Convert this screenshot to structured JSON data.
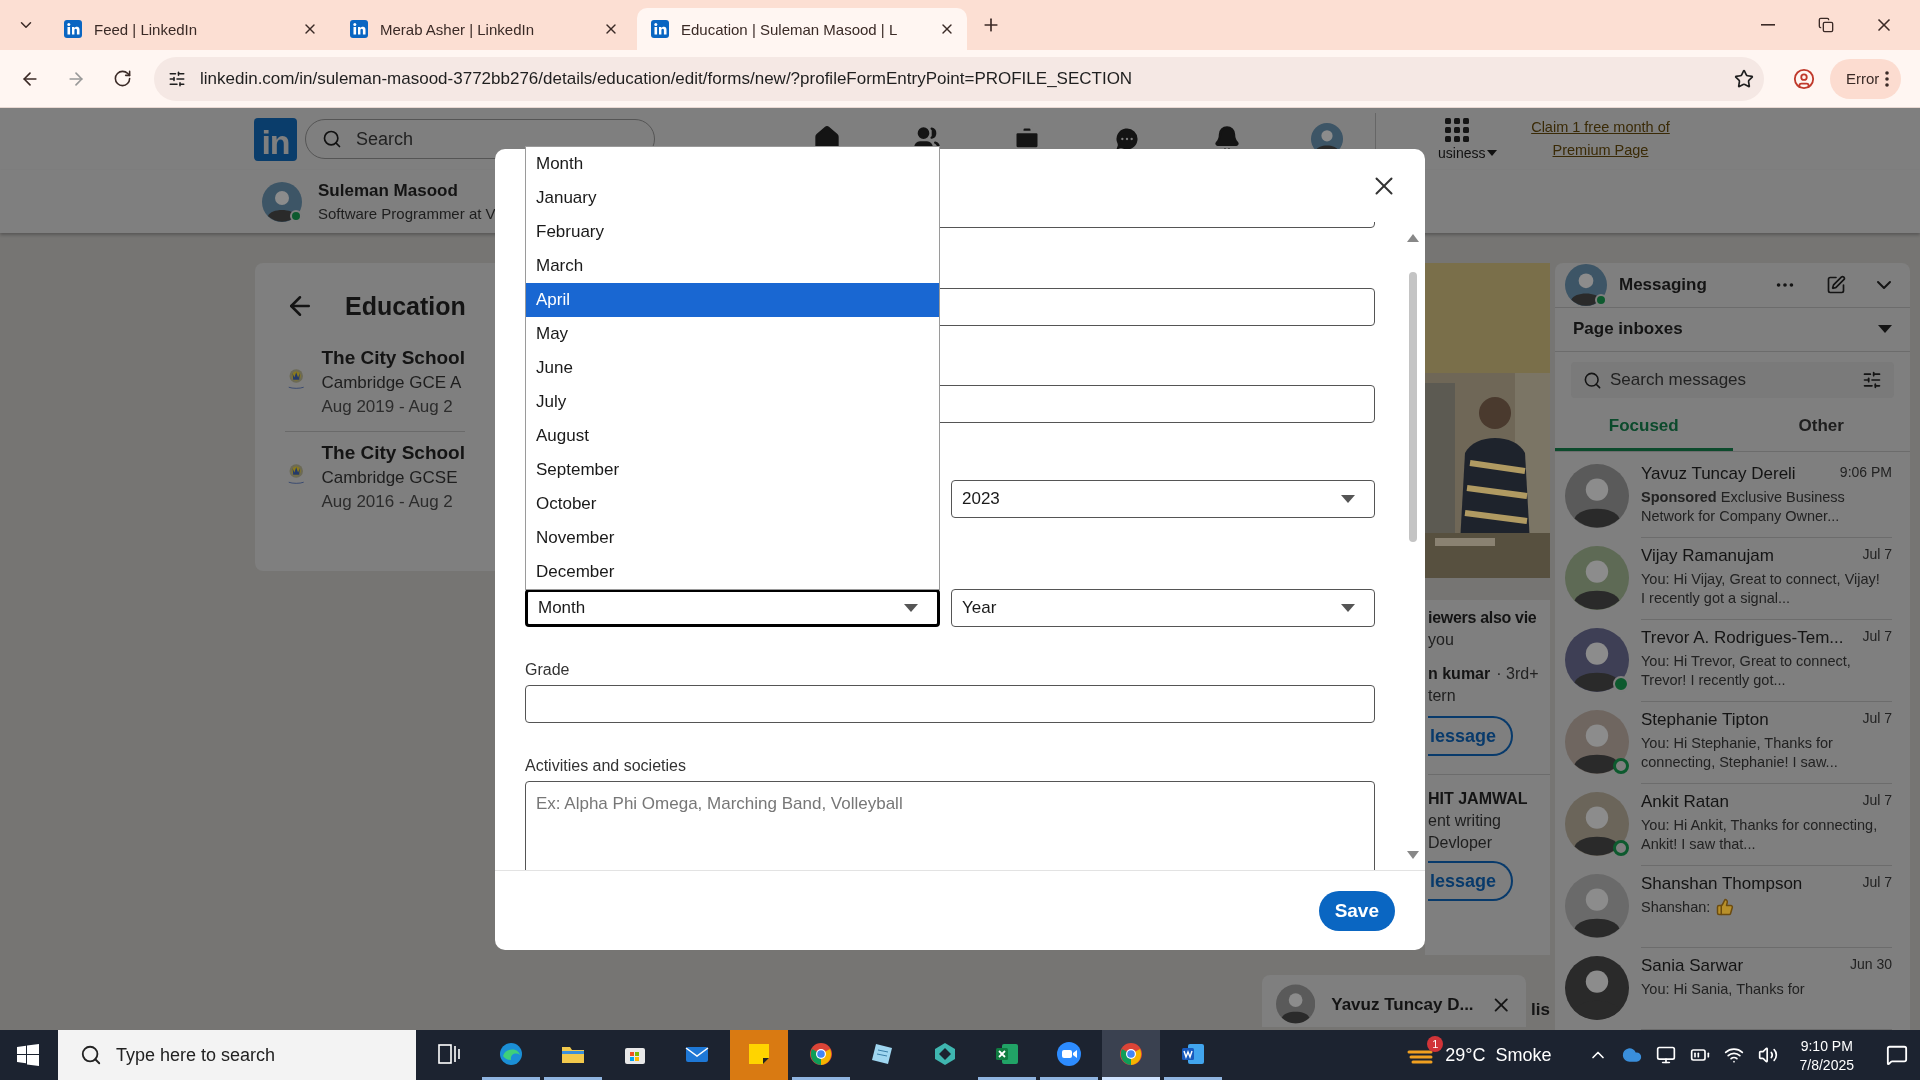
{
  "browser": {
    "tabs": [
      {
        "title": "Feed | LinkedIn",
        "selected": false
      },
      {
        "title": "Merab Asher | LinkedIn",
        "selected": false
      },
      {
        "title": "Education | Suleman Masood | L",
        "selected": true
      }
    ],
    "url": "linkedin.com/in/suleman-masood-3772bb276/details/education/edit/forms/new/?profileFormEntryPoint=PROFILE_SECTION",
    "profile_button": "Error"
  },
  "nav": {
    "logo": "in",
    "search_placeholder": "Search",
    "business": "usiness",
    "premium_link": "Claim 1 free month of Premium Page"
  },
  "profile_bar": {
    "name": "Suleman Masood",
    "headline": "Software Programmer at V"
  },
  "education": {
    "title": "Education",
    "entries": [
      {
        "school": "The City School",
        "degree": "Cambridge GCE A",
        "dates": "Aug 2019 - Aug 2"
      },
      {
        "school": "The City School",
        "degree": "Cambridge GCSE",
        "dates": "Aug 2016 - Aug 2"
      }
    ]
  },
  "side_rail": {
    "heading": "iewers also vie",
    "subheading": "you",
    "people": [
      {
        "name": "n kumar",
        "degree": "· 3rd+",
        "headline": [
          "tern"
        ],
        "button": "lessage"
      },
      {
        "name": "HIT JAMWAL",
        "headline": [
          "ent writing",
          "Devloper"
        ],
        "button": "lessage"
      }
    ],
    "trailing": "lis"
  },
  "messaging": {
    "title": "Messaging",
    "inbox_selector": "Page inboxes",
    "search_placeholder": "Search messages",
    "tabs": [
      {
        "label": "Focused",
        "selected": true
      },
      {
        "label": "Other",
        "selected": false
      }
    ],
    "conversations": [
      {
        "name": "Yavuz Tuncay Dereli",
        "time": "9:06 PM",
        "snippet": "**Sponsored**  Exclusive Business Network for Company Owner...",
        "online": false,
        "recently_active": false,
        "reaction": false
      },
      {
        "name": "Vijay Ramanujam",
        "time": "Jul 7",
        "snippet": "You: Hi Vijay, Great to connect, Vijay! I recently got a signal...",
        "online": false,
        "recently_active": false,
        "reaction": false
      },
      {
        "name": "Trevor A. Rodrigues-Tem...",
        "time": "Jul 7",
        "snippet": "You: Hi Trevor, Great to connect, Trevor! I recently got...",
        "online": true,
        "recently_active": false,
        "reaction": false
      },
      {
        "name": "Stephanie Tipton",
        "time": "Jul 7",
        "snippet": "You: Hi Stephanie, Thanks for connecting, Stephanie! I saw...",
        "online": false,
        "recently_active": true,
        "reaction": false
      },
      {
        "name": "Ankit Ratan",
        "time": "Jul 7",
        "snippet": "You: Hi Ankit, Thanks for connecting, Ankit! I saw that...",
        "online": false,
        "recently_active": true,
        "reaction": false
      },
      {
        "name": "Shanshan Thompson",
        "time": "Jul 7",
        "snippet": "Shanshan:",
        "online": false,
        "recently_active": false,
        "reaction": true
      },
      {
        "name": "Sania Sarwar",
        "time": "Jun 30",
        "snippet": "You: Hi Sania, Thanks for",
        "online": false,
        "recently_active": false,
        "reaction": false
      }
    ]
  },
  "chat_bubble": {
    "name": "Yavuz Tuncay D..."
  },
  "modal": {
    "start_year": "2023",
    "end_month": {
      "value": "Month",
      "focused": true
    },
    "end_year": {
      "value": "Year",
      "focused": false
    },
    "grade_label": "Grade",
    "activities_label": "Activities and societies",
    "activities_placeholder": "Ex: Alpha Phi Omega, Marching Band, Volleyball",
    "save": "Save",
    "month_options": [
      {
        "label": "Month",
        "selected": false
      },
      {
        "label": "January",
        "selected": false
      },
      {
        "label": "February",
        "selected": false
      },
      {
        "label": "March",
        "selected": false
      },
      {
        "label": "April",
        "selected": true
      },
      {
        "label": "May",
        "selected": false
      },
      {
        "label": "June",
        "selected": false
      },
      {
        "label": "July",
        "selected": false
      },
      {
        "label": "August",
        "selected": false
      },
      {
        "label": "September",
        "selected": false
      },
      {
        "label": "October",
        "selected": false
      },
      {
        "label": "November",
        "selected": false
      },
      {
        "label": "December",
        "selected": false
      }
    ]
  },
  "taskbar": {
    "search_placeholder": "Type here to search",
    "apps": [
      {
        "kind": "task-view",
        "open": false,
        "flashing": false,
        "selected": false
      },
      {
        "kind": "edge",
        "open": true,
        "flashing": false,
        "selected": false
      },
      {
        "kind": "folder",
        "open": true,
        "flashing": false,
        "selected": false
      },
      {
        "kind": "store",
        "open": false,
        "flashing": false,
        "selected": false
      },
      {
        "kind": "mail",
        "open": false,
        "flashing": false,
        "selected": false
      },
      {
        "kind": "notes",
        "open": false,
        "flashing": true,
        "selected": false
      },
      {
        "kind": "chrome",
        "open": true,
        "flashing": false,
        "selected": false
      },
      {
        "kind": "pad",
        "open": false,
        "flashing": false,
        "selected": false
      },
      {
        "kind": "hexagon",
        "open": false,
        "flashing": false,
        "selected": false
      },
      {
        "kind": "sheet",
        "open": true,
        "flashing": false,
        "selected": false
      },
      {
        "kind": "video",
        "open": true,
        "flashing": false,
        "selected": false
      },
      {
        "kind": "chrome",
        "open": true,
        "flashing": false,
        "selected": true
      },
      {
        "kind": "doc",
        "open": true,
        "flashing": false,
        "selected": false
      }
    ],
    "weather": {
      "badge": "1",
      "text": "29°C  Smoke"
    },
    "time": "9:10 PM",
    "date": "7/8/2025"
  }
}
